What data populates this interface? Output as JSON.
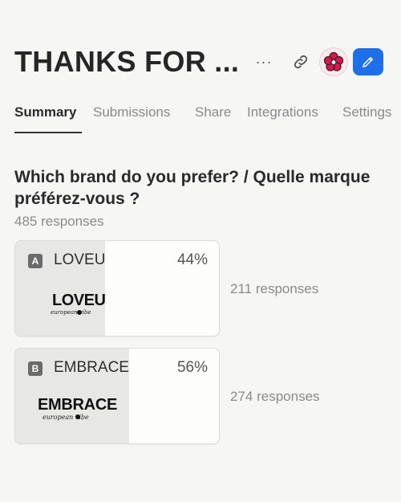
{
  "header": {
    "title": "THANKS FOR ...",
    "more_icon": "more-icon",
    "link_icon": "link-icon",
    "avatar_icon": "flower-avatar-icon",
    "edit_icon": "pencil-icon",
    "accent": "#1f6fe8"
  },
  "tabs": [
    {
      "label": "Summary",
      "active": true
    },
    {
      "label": "Submissions"
    },
    {
      "label": "Share"
    },
    {
      "label": "Integrations"
    },
    {
      "label": "Settings"
    }
  ],
  "question": {
    "text": "Which brand do you prefer? / Quelle marque préférez-vous ?",
    "response_count": "485 responses",
    "options": [
      {
        "letter": "A",
        "label": "LOVEU",
        "percent": "44%",
        "fraction": 0.44,
        "responses": "211 responses",
        "logo_text": "LOVEU",
        "logo_sub": "european vibe"
      },
      {
        "letter": "B",
        "label": "EMBRACE",
        "percent": "56%",
        "fraction": 0.56,
        "responses": "274 responses",
        "logo_text": "EMBRACE",
        "logo_sub": "european vibe"
      }
    ]
  }
}
